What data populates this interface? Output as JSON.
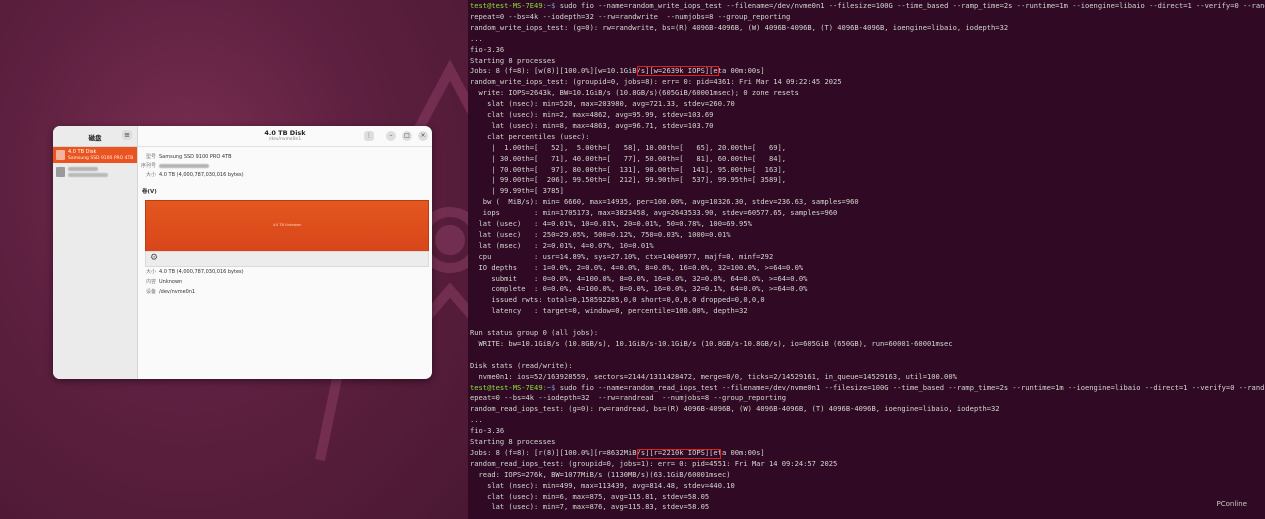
{
  "disks_app": {
    "title": "磁盘",
    "header_title": "4.0 TB Disk",
    "header_subtitle": "/dev/nvme0n1",
    "sidebar_items": [
      {
        "label": "4.0 TB Disk",
        "sublabel": "Samsung SSD 9100 PRO 4TB"
      }
    ],
    "info": {
      "model_label": "型号",
      "model_value": "Samsung SSD 9100 PRO 4TB",
      "serial_label": "序列号",
      "size_label": "大小",
      "size_value": "4.0 TB (4,000,787,030,016 bytes)"
    },
    "volumes_label": "卷(V)",
    "volume_bar_text": "4.0 TB Unknown",
    "volume_info": {
      "size_label": "大小",
      "size_value": "4.0 TB (4,000,787,030,016 bytes)",
      "content_label": "内容",
      "content_value": "Unknown",
      "device_label": "设备",
      "device_value": "/dev/nvme0n1"
    }
  },
  "terminal": {
    "lines": [
      {
        "user": "test@test-MS-7E49",
        "path": ":~$",
        "text": " sudo fio --name=random_write_iops_test --filename=/dev/nvme0n1 --filesize=100G --time_based --ramp_time=2s --runtime=1m --ioengine=libaio --direct=1 --verify=0 --rand"
      },
      {
        "text": "repeat=0 --bs=4k --iodepth=32 --rw=randwrite  --numjobs=8 --group_reporting"
      },
      {
        "text": "random_write_iops_test: (g=0): rw=randwrite, bs=(R) 4096B-4096B, (W) 4096B-4096B, (T) 4096B-4096B, ioengine=libaio, iodepth=32"
      },
      {
        "text": "..."
      },
      {
        "text": "fio-3.36"
      },
      {
        "text": "Starting 8 processes"
      },
      {
        "text": "Jobs: 8 (f=8): [w(8)][100.0%][w=10.1GiB/s][w=2639k IOPS][eta 00m:00s]"
      },
      {
        "text": "random_write_iops_test: (groupid=0, jobs=8): err= 0: pid=4361: Fri Mar 14 09:22:45 2025"
      },
      {
        "text": "  write: IOPS=2643k, BW=10.1GiB/s (10.8GB/s)(605GiB/60001msec); 0 zone resets"
      },
      {
        "text": "    slat (nsec): min=520, max=203980, avg=721.33, stdev=260.70"
      },
      {
        "text": "    clat (usec): min=2, max=4862, avg=95.99, stdev=103.69"
      },
      {
        "text": "     lat (usec): min=8, max=4863, avg=96.71, stdev=103.70"
      },
      {
        "text": "    clat percentiles (usec):"
      },
      {
        "text": "     |  1.00th=[   52],  5.00th=[   58], 10.00th=[   65], 20.00th=[   69],"
      },
      {
        "text": "     | 30.00th=[   71], 40.00th=[   77], 50.00th=[   81], 60.00th=[   84],"
      },
      {
        "text": "     | 70.00th=[   97], 80.00th=[  131], 90.00th=[  141], 95.00th=[  163],"
      },
      {
        "text": "     | 99.00th=[  206], 99.50th=[  212], 99.90th=[  537], 99.95th=[ 3589],"
      },
      {
        "text": "     | 99.99th=[ 3785]"
      },
      {
        "text": "   bw (  MiB/s): min= 6660, max=14935, per=100.00%, avg=10326.30, stdev=236.63, samples=960"
      },
      {
        "text": "   iops        : min=1705173, max=3823458, avg=2643533.90, stdev=60577.65, samples=960"
      },
      {
        "text": "  lat (usec)   : 4=0.01%, 10=0.01%, 20=0.01%, 50=0.78%, 100=69.95%"
      },
      {
        "text": "  lat (usec)   : 250=29.05%, 500=0.12%, 750=0.03%, 1000=0.01%"
      },
      {
        "text": "  lat (msec)   : 2=0.01%, 4=0.07%, 10=0.01%"
      },
      {
        "text": "  cpu          : usr=14.89%, sys=27.10%, ctx=14040977, majf=0, minf=292"
      },
      {
        "text": "  IO depths    : 1=0.0%, 2=0.0%, 4=0.0%, 8=0.0%, 16=0.0%, 32=100.0%, >=64=0.0%"
      },
      {
        "text": "     submit    : 0=0.0%, 4=100.0%, 8=0.0%, 16=0.0%, 32=0.0%, 64=0.0%, >=64=0.0%"
      },
      {
        "text": "     complete  : 0=0.0%, 4=100.0%, 8=0.0%, 16=0.0%, 32=0.1%, 64=0.0%, >=64=0.0%"
      },
      {
        "text": "     issued rwts: total=0,158592285,0,0 short=0,0,0,0 dropped=0,0,0,0"
      },
      {
        "text": "     latency   : target=0, window=0, percentile=100.00%, depth=32"
      },
      {
        "text": ""
      },
      {
        "text": "Run status group 0 (all jobs):"
      },
      {
        "text": "  WRITE: bw=10.1GiB/s (10.8GB/s), 10.1GiB/s-10.1GiB/s (10.8GB/s-10.8GB/s), io=605GiB (650GB), run=60001-60001msec"
      },
      {
        "text": ""
      },
      {
        "text": "Disk stats (read/write):"
      },
      {
        "text": "  nvme0n1: ios=52/163928559, sectors=2144/1311428472, merge=0/0, ticks=2/14529161, in_queue=14529163, util=100.00%"
      },
      {
        "user": "test@test-MS-7E49",
        "path": ":~$",
        "text": " sudo fio --name=random_read_iops_test --filename=/dev/nvme0n1 --filesize=100G --time_based --ramp_time=2s --runtime=1m --ioengine=libaio --direct=1 --verify=0 --randr"
      },
      {
        "text": "epeat=0 --bs=4k --iodepth=32  --rw=randread  --numjobs=8 --group_reporting"
      },
      {
        "text": "random_read_iops_test: (g=0): rw=randread, bs=(R) 4096B-4096B, (W) 4096B-4096B, (T) 4096B-4096B, ioengine=libaio, iodepth=32"
      },
      {
        "text": "..."
      },
      {
        "text": "fio-3.36"
      },
      {
        "text": "Starting 8 processes"
      },
      {
        "text": "Jobs: 8 (f=8): [r(8)][100.0%][r=8632MiB/s][r=2210k IOPS][eta 00m:00s]"
      },
      {
        "text": "random_read_iops_test: (groupid=0, jobs=1): err= 0: pid=4551: Fri Mar 14 09:24:57 2025"
      },
      {
        "text": "  read: IOPS=276k, BW=1077MiB/s (1130MB/s)(63.1GiB/60001msec)"
      },
      {
        "text": "    slat (nsec): min=499, max=113439, avg=814.48, stdev=440.10"
      },
      {
        "text": "    clat (usec): min=6, max=875, avg=115.81, stdev=58.05"
      },
      {
        "text": "     lat (usec): min=7, max=876, avg=115.83, stdev=58.05"
      }
    ]
  },
  "watermark": "PConline",
  "colors": {
    "accent": "#e95420",
    "terminal_bg": "#300a24",
    "highlight": "#e02020"
  }
}
